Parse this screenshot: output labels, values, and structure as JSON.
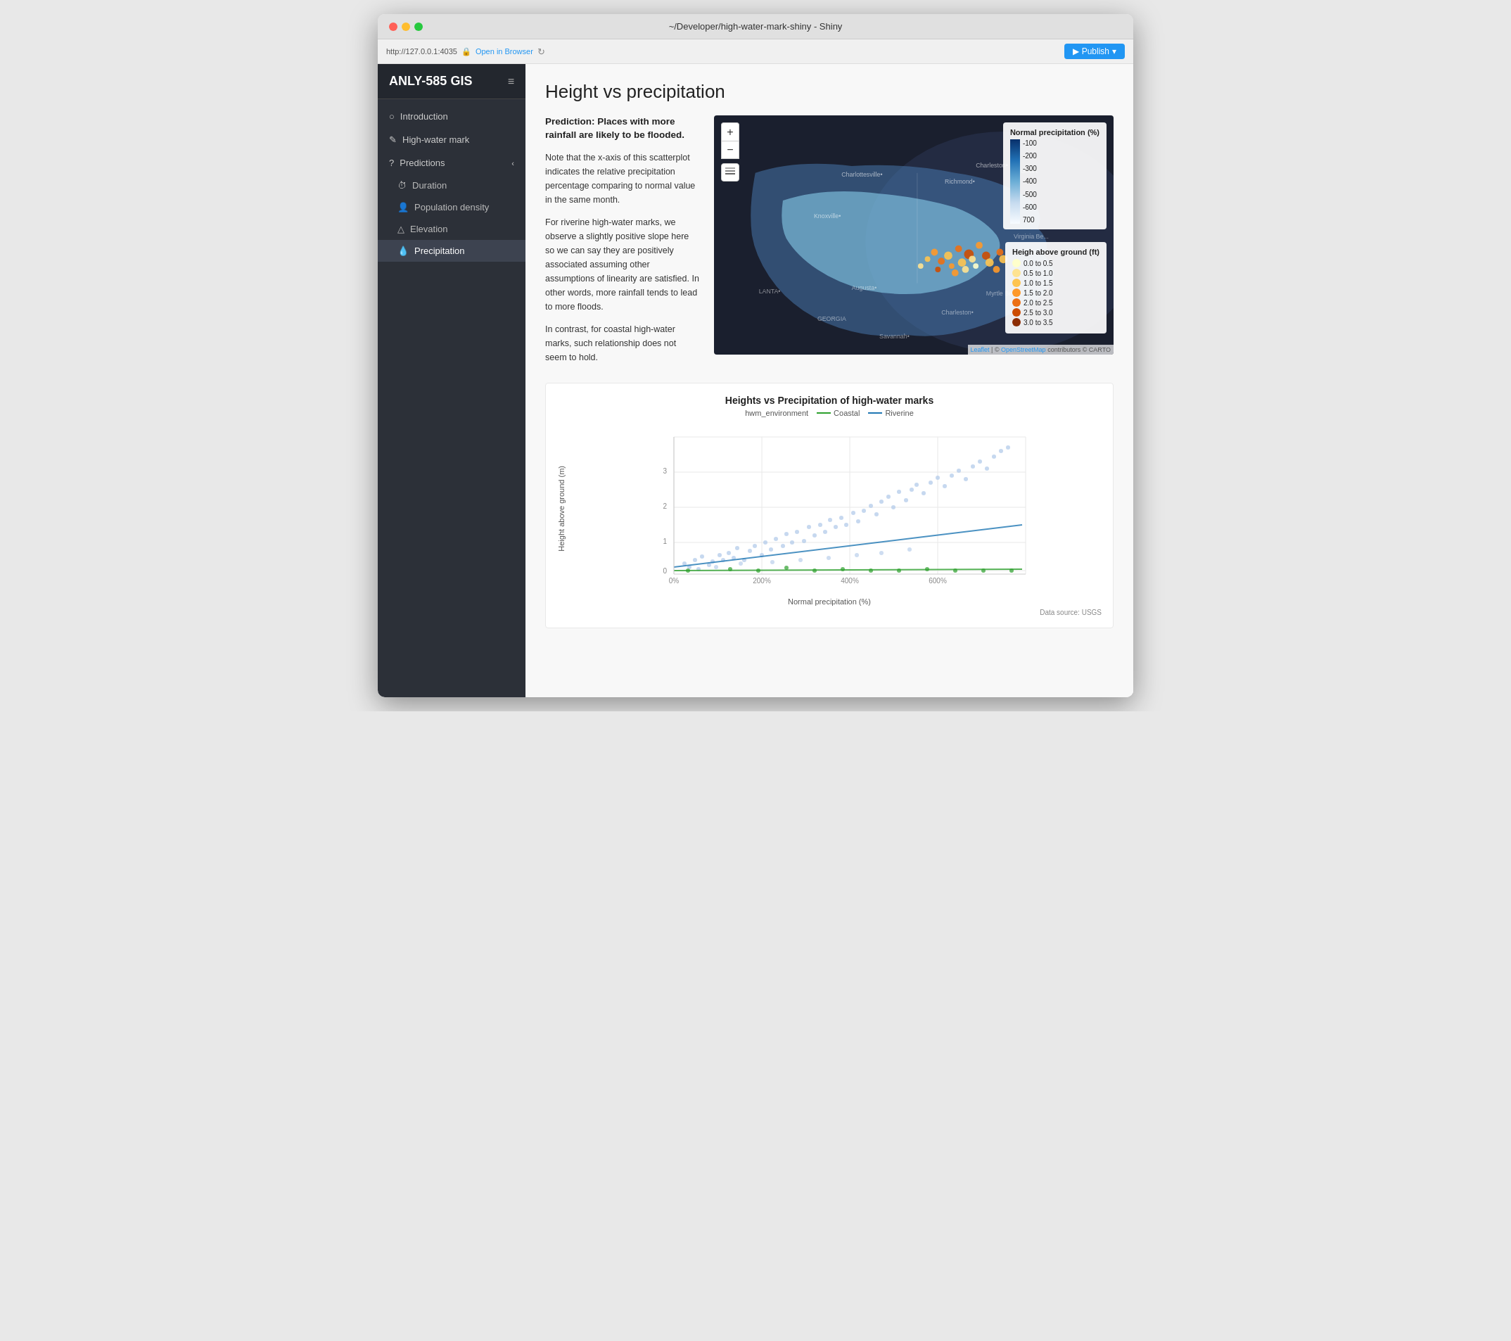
{
  "browser": {
    "title": "~/Developer/high-water-mark-shiny - Shiny",
    "url": "http://127.0.0.1:4035",
    "open_in_browser": "Open in Browser",
    "publish_label": "Publish"
  },
  "sidebar": {
    "brand": "ANLY-585 GIS",
    "items": [
      {
        "id": "introduction",
        "label": "Introduction",
        "icon": "○",
        "active": false,
        "level": 0
      },
      {
        "id": "high-water-mark",
        "label": "High-water mark",
        "icon": "✎",
        "active": false,
        "level": 0
      },
      {
        "id": "predictions",
        "label": "Predictions",
        "icon": "?",
        "active": false,
        "level": 0,
        "expanded": true
      },
      {
        "id": "duration",
        "label": "Duration",
        "icon": "⏱",
        "active": false,
        "level": 1
      },
      {
        "id": "population-density",
        "label": "Population density",
        "icon": "👤",
        "active": false,
        "level": 1
      },
      {
        "id": "elevation",
        "label": "Elevation",
        "icon": "△",
        "active": false,
        "level": 1
      },
      {
        "id": "precipitation",
        "label": "Precipitation",
        "icon": "💧",
        "active": true,
        "level": 1
      }
    ]
  },
  "main": {
    "page_title": "Height vs precipitation",
    "prediction_label": "Prediction: Places with more rainfall are likely to be flooded.",
    "body_paragraphs": [
      "Note that the x-axis of this scatterplot indicates the relative precipitation percentage comparing to normal value in the same month.",
      "For riverine high-water marks, we observe a slightly positive slope here so we can say they are positively associated assuming other assumptions of linearity are satisfied. In other words, more rainfall tends to lead to more floods.",
      "In contrast, for coastal high-water marks, such relationship does not seem to hold."
    ],
    "map": {
      "legend_precip_title": "Normal precipitation (%)",
      "legend_precip_values": [
        "-100",
        "-200",
        "-300",
        "-400",
        "-500",
        "-600",
        "700"
      ],
      "legend_height_title": "Heigh above ground (ft)",
      "legend_height_items": [
        {
          "label": "0.0 to 0.5",
          "color": "#ffffcc"
        },
        {
          "label": "0.5 to 1.0",
          "color": "#fee391"
        },
        {
          "label": "1.0 to 1.5",
          "color": "#fec44f"
        },
        {
          "label": "1.5 to 2.0",
          "color": "#fe9929"
        },
        {
          "label": "2.0 to 2.5",
          "color": "#ec7014"
        },
        {
          "label": "2.5 to 3.0",
          "color": "#cc4c02"
        },
        {
          "label": "3.0 to 3.5",
          "color": "#8c2d04"
        }
      ],
      "attribution": "Leaflet | © OpenStreetMap contributors © CARTO"
    },
    "chart": {
      "title": "Heights vs Precipitation of high-water marks",
      "legend_env_label": "hwm_environment",
      "legend_coastal_label": "Coastal",
      "legend_riverine_label": "Riverine",
      "y_axis_label": "Height above ground (m)",
      "x_axis_label": "Normal precipitation (%)",
      "x_ticks": [
        "0%",
        "200%",
        "400%",
        "600%"
      ],
      "y_ticks": [
        "0",
        "1",
        "2",
        "3"
      ],
      "data_source": "Data source: USGS"
    }
  }
}
